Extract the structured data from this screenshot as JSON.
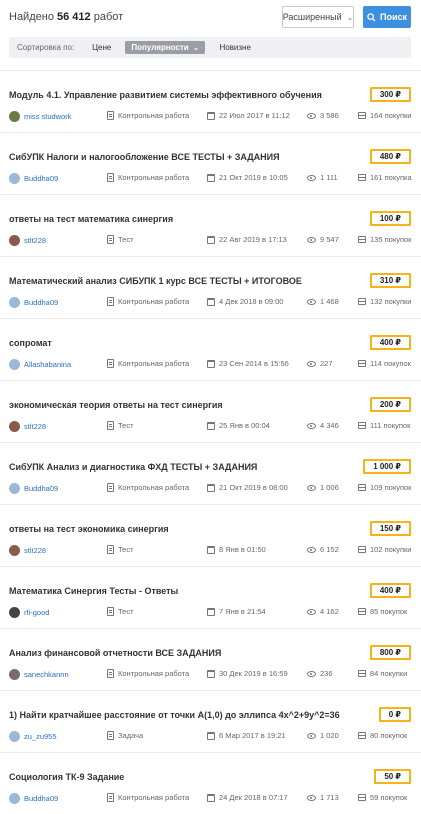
{
  "header": {
    "found_label": "Найдено",
    "found_count": "56 412",
    "found_suffix": "работ",
    "advanced_label": "Расширенный",
    "search_label": "Поиск"
  },
  "sort": {
    "label": "Сортировка по:",
    "price": "Цене",
    "popularity": "Популярности",
    "newness": "Новизне"
  },
  "colors": {
    "accent": "#3d8fe0",
    "price_border": "#f5b21b",
    "author": "#2a6fc2"
  },
  "items": [
    {
      "title": "Модуль 4.1. Управление развитием системы эффективного обучения",
      "price": "300 ₽",
      "author": "miss studwork",
      "type": "Контрольная работа",
      "date": "22 Июл 2017 в 11:12",
      "views": "3 586",
      "purchases": "164 покупки",
      "avatar_color": "#6a7a4a"
    },
    {
      "title": "СибУПК Налоги и налогообложение ВСЕ ТЕСТЫ + ЗАДАНИЯ",
      "price": "480 ₽",
      "author": "Buddha09",
      "type": "Контрольная работа",
      "date": "21 Окт 2019 в 10:05",
      "views": "1 111",
      "purchases": "161 покупка",
      "avatar_color": "#9ab8d8"
    },
    {
      "title": "ответы на тест математика синергия",
      "price": "100 ₽",
      "author": "stlt228",
      "type": "Тест",
      "date": "22 Авг 2019 в 17:13",
      "views": "9 547",
      "purchases": "135 покупок",
      "avatar_color": "#8a5a4a"
    },
    {
      "title": "Математический анализ СИБУПК 1 курс ВСЕ ТЕСТЫ + ИТОГОВОЕ",
      "price": "310 ₽",
      "author": "Buddha09",
      "type": "Контрольная работа",
      "date": "4 Дек 2018 в 09:00",
      "views": "1 468",
      "purchases": "132 покупки",
      "avatar_color": "#9ab8d8"
    },
    {
      "title": "сопромат",
      "price": "400 ₽",
      "author": "Allashabanina",
      "type": "Контрольная работа",
      "date": "23 Сен 2014 в 15:56",
      "views": "227",
      "purchases": "114 покупок",
      "avatar_color": "#9ab8d8"
    },
    {
      "title": "экономическая теория ответы на тест синергия",
      "price": "200 ₽",
      "author": "stlt228",
      "type": "Тест",
      "date": "25 Янв в 00:04",
      "views": "4 346",
      "purchases": "111 покупок",
      "avatar_color": "#8a5a4a"
    },
    {
      "title": "СибУПК Анализ и диагностика ФХД ТЕСТЫ + ЗАДАНИЯ",
      "price": "1 000 ₽",
      "author": "Buddha09",
      "type": "Контрольная работа",
      "date": "21 Окт 2019 в 08:00",
      "views": "1 006",
      "purchases": "109 покупок",
      "avatar_color": "#9ab8d8"
    },
    {
      "title": "ответы на тест экономика синергия",
      "price": "150 ₽",
      "author": "stlt228",
      "type": "Тест",
      "date": "8 Янв в 01:50",
      "views": "6 152",
      "purchases": "102 покупки",
      "avatar_color": "#8a5a4a"
    },
    {
      "title": "Математика Синергия Тесты - Ответы",
      "price": "400 ₽",
      "author": "rfi-good",
      "type": "Тест",
      "date": "7 Янв в 21:54",
      "views": "4 162",
      "purchases": "85 покупок",
      "avatar_color": "#444444"
    },
    {
      "title": "Анализ финансовой отчетности ВСЕ ЗАДАНИЯ",
      "price": "800 ₽",
      "author": "sanechkannn",
      "type": "Контрольная работа",
      "date": "30 Дек 2019 в 16:59",
      "views": "236",
      "purchases": "84 покупки",
      "avatar_color": "#7a6a6a"
    },
    {
      "title": "1) Найти кратчайшее расстояние от точки A(1,0) до эллипса 4x^2+9y^2=36",
      "price": "0 ₽",
      "author": "zu_zu955",
      "type": "Задача",
      "date": "6 Мар 2017 в 19:21",
      "views": "1 020",
      "purchases": "80 покупок",
      "avatar_color": "#9ab8d8"
    },
    {
      "title": "Социология ТК-9 Задание",
      "price": "50 ₽",
      "author": "Buddha09",
      "type": "Контрольная работа",
      "date": "24 Дек 2018 в 07:17",
      "views": "1 713",
      "purchases": "59 покупок",
      "avatar_color": "#9ab8d8"
    }
  ]
}
